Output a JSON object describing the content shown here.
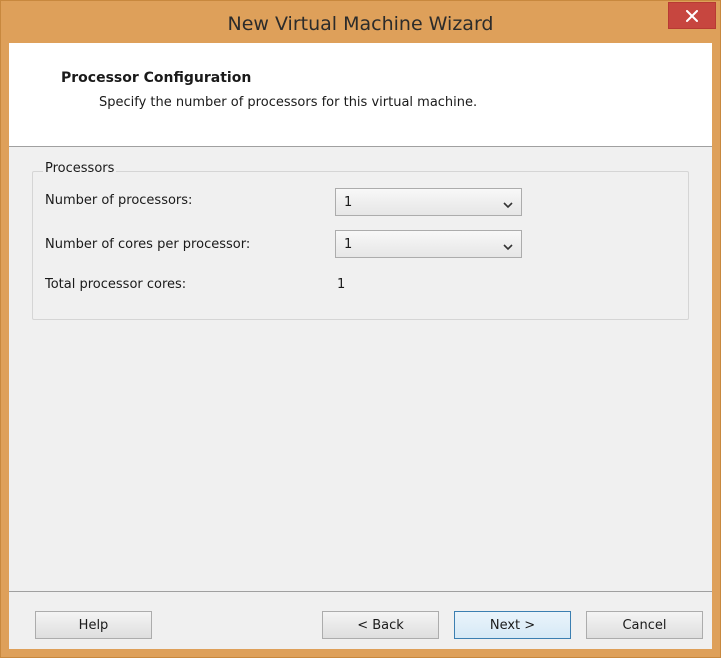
{
  "window": {
    "title": "New Virtual Machine Wizard"
  },
  "header": {
    "title": "Processor Configuration",
    "subtitle": "Specify the number of processors for this virtual machine."
  },
  "processors": {
    "group_label": "Processors",
    "num_processors_label": "Number of processors:",
    "num_processors_value": "1",
    "cores_per_processor_label": "Number of cores per processor:",
    "cores_per_processor_value": "1",
    "total_cores_label": "Total processor cores:",
    "total_cores_value": "1"
  },
  "buttons": {
    "help": "Help",
    "back": "< Back",
    "next": "Next >",
    "cancel": "Cancel"
  },
  "icons": {
    "close": "close-icon",
    "dropdown": "chevron-down-icon"
  },
  "colors": {
    "frame": "#dea05a",
    "close_button": "#c7463f",
    "default_button_border": "#3c7fb1"
  }
}
